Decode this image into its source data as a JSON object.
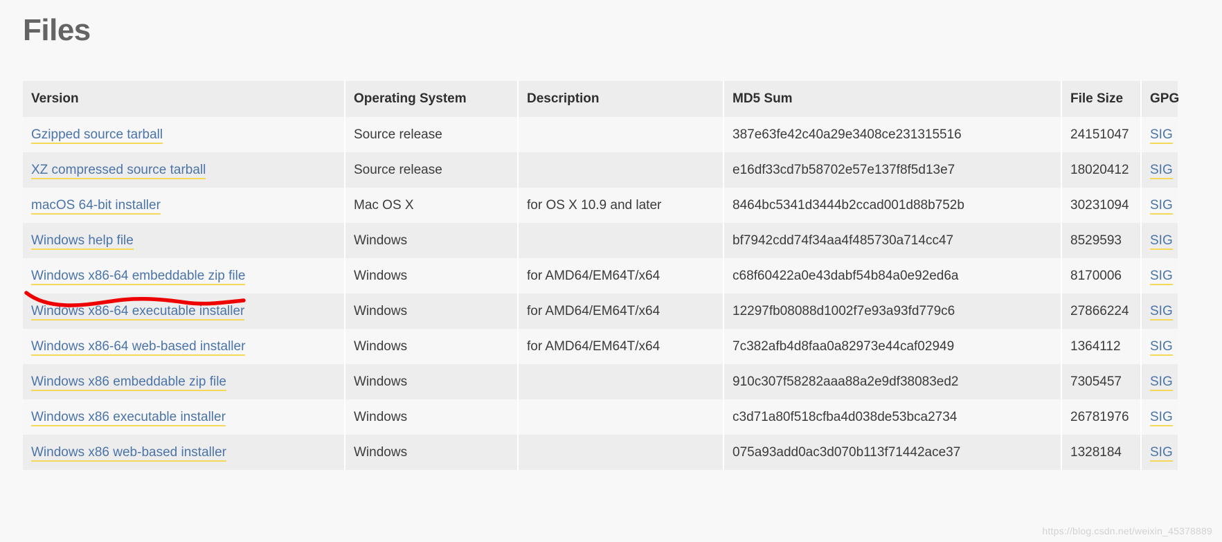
{
  "page": {
    "title": "Files",
    "watermark": "https://blog.csdn.net/weixin_45378889"
  },
  "colors": {
    "link": "#4b74a8",
    "link_underline": "#f5d858",
    "header_bg": "#ededed",
    "row_odd_bg": "#f7f7f7",
    "row_even_bg": "#ededed",
    "page_bg": "#f8f8f8",
    "title_text": "#646464",
    "annotation": "#ee0000"
  },
  "table": {
    "columns": [
      {
        "key": "version",
        "label": "Version"
      },
      {
        "key": "os",
        "label": "Operating System"
      },
      {
        "key": "description",
        "label": "Description"
      },
      {
        "key": "md5",
        "label": "MD5 Sum"
      },
      {
        "key": "size",
        "label": "File Size"
      },
      {
        "key": "gpg",
        "label": "GPG"
      }
    ],
    "rows": [
      {
        "version": "Gzipped source tarball",
        "os": "Source release",
        "description": "",
        "md5": "387e63fe42c40a29e3408ce231315516",
        "size": "24151047",
        "gpg": "SIG"
      },
      {
        "version": "XZ compressed source tarball",
        "os": "Source release",
        "description": "",
        "md5": "e16df33cd7b58702e57e137f8f5d13e7",
        "size": "18020412",
        "gpg": "SIG"
      },
      {
        "version": "macOS 64-bit installer",
        "os": "Mac OS X",
        "description": "for OS X 10.9 and later",
        "md5": "8464bc5341d3444b2ccad001d88b752b",
        "size": "30231094",
        "gpg": "SIG"
      },
      {
        "version": "Windows help file",
        "os": "Windows",
        "description": "",
        "md5": "bf7942cdd74f34aa4f485730a714cc47",
        "size": "8529593",
        "gpg": "SIG"
      },
      {
        "version": "Windows x86-64 embeddable zip file",
        "os": "Windows",
        "description": "for AMD64/EM64T/x64",
        "md5": "c68f60422a0e43dabf54b84a0e92ed6a",
        "size": "8170006",
        "gpg": "SIG"
      },
      {
        "version": "Windows x86-64 executable installer",
        "os": "Windows",
        "description": "for AMD64/EM64T/x64",
        "md5": "12297fb08088d1002f7e93a93fd779c6",
        "size": "27866224",
        "gpg": "SIG"
      },
      {
        "version": "Windows x86-64 web-based installer",
        "os": "Windows",
        "description": "for AMD64/EM64T/x64",
        "md5": "7c382afb4d8faa0a82973e44caf02949",
        "size": "1364112",
        "gpg": "SIG"
      },
      {
        "version": "Windows x86 embeddable zip file",
        "os": "Windows",
        "description": "",
        "md5": "910c307f58282aaa88a2e9df38083ed2",
        "size": "7305457",
        "gpg": "SIG"
      },
      {
        "version": "Windows x86 executable installer",
        "os": "Windows",
        "description": "",
        "md5": "c3d71a80f518cfba4d038de53bca2734",
        "size": "26781976",
        "gpg": "SIG"
      },
      {
        "version": "Windows x86 web-based installer",
        "os": "Windows",
        "description": "",
        "md5": "075a93add0ac3d070b113f71442ace37",
        "size": "1328184",
        "gpg": "SIG"
      }
    ]
  },
  "annotations": [
    {
      "type": "freehand-underline",
      "target_row_index": 5,
      "target_text": "Windows x86-64 executable installer",
      "color": "#ee0000"
    }
  ]
}
